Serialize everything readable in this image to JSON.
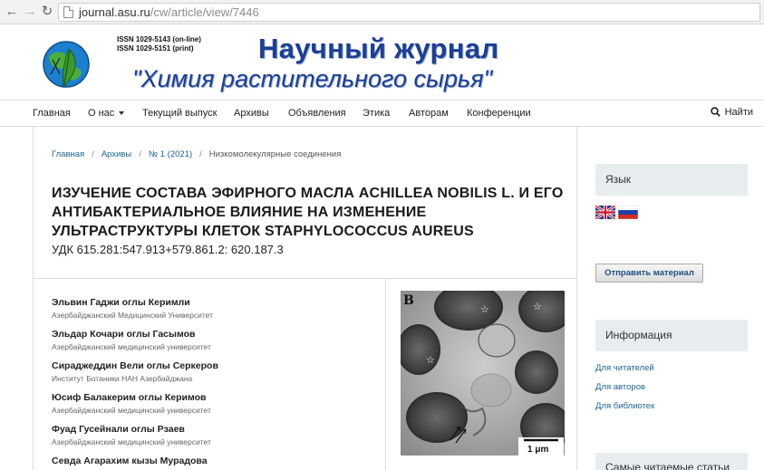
{
  "browser": {
    "url_host": "journal.asu.ru",
    "url_path": "/cw/article/view/7446"
  },
  "header": {
    "issn_online": "ISSN 1029-5143 (on-line)",
    "issn_print": "ISSN 1029-5151 (print)",
    "title_line1": "Научный журнал",
    "title_line2": "\"Химия растительного сырья\""
  },
  "nav": {
    "items": [
      "Главная",
      "О нас",
      "Текущий выпуск",
      "Архивы",
      "Объявления",
      "Этика",
      "Авторам",
      "Конференции"
    ],
    "search_label": "Найти"
  },
  "breadcrumb": {
    "home": "Главная",
    "archives": "Архивы",
    "issue": "№ 1 (2021)",
    "section": "Низкомолекулярные соединения"
  },
  "article": {
    "title": "ИЗУЧЕНИЕ СОСТАВА ЭФИРНОГО МАСЛА ACHILLEA NOBILIS L. И ЕГО АНТИБАКТЕРИАЛЬНОЕ ВЛИЯНИЕ НА ИЗМЕНЕНИЕ УЛЬТРАСТРУКТУРЫ КЛЕТОК STAPHYLOCOCCUS AUREUS",
    "udk": "УДК 615.281:547.913+579.861.2: 620.187.3",
    "authors": [
      {
        "name": "Эльвин Гаджи оглы Керимли",
        "affiliation": "Азербайджанский Медицинский Университет"
      },
      {
        "name": "Эльдар Кочари оглы Гасымов",
        "affiliation": "Азербайджанский медицинский университет"
      },
      {
        "name": "Сираджеддин Вели оглы Серкеров",
        "affiliation": "Институт Ботаники НАН Азербайджана"
      },
      {
        "name": "Юсиф Балакерим оглы Керимов",
        "affiliation": "Азербайджанский медицинский университет"
      },
      {
        "name": "Фуад Гусейнали оглы Рзаев",
        "affiliation": "Азербайджанский медицинский университет"
      },
      {
        "name": "Севда Агарахим кызы Мурадова",
        "affiliation": ""
      }
    ],
    "figure": {
      "panel_label": "B",
      "scale_label": "1 μm"
    }
  },
  "sidebar": {
    "language_title": "Язык",
    "submit_button": "Отправить материал",
    "info_title": "Информация",
    "info_links": [
      "Для читателей",
      "Для авторов",
      "Для библиотек"
    ],
    "most_read_title": "Самые читаемые статьи"
  },
  "colors": {
    "journal_blue": "#1b3f95",
    "link_blue": "#1e6292",
    "sidebar_header_bg": "#e7ecef"
  }
}
